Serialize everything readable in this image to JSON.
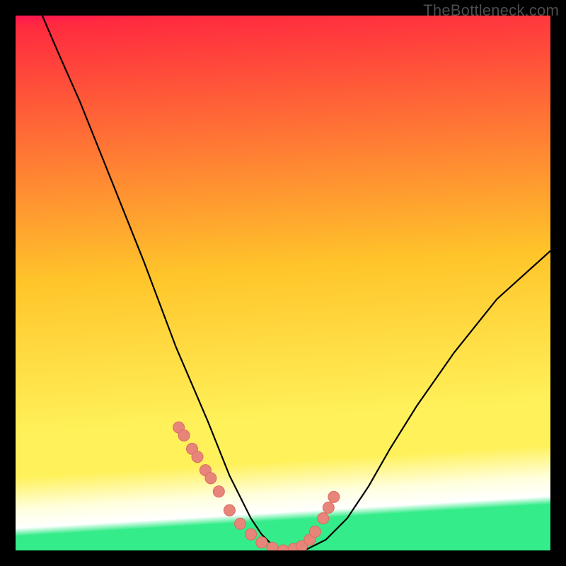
{
  "watermark": "TheBottleneck.com",
  "colors": {
    "grad_top_left": "#ff1452",
    "grad_top_right": "#ff2a3f",
    "grad_mid": "#ffc52a",
    "grad_low": "#fff15a",
    "grad_pale": "#ffffde",
    "grad_green": "#35ec8a",
    "curve": "#000000",
    "beads": "#e8857a",
    "beads_stroke": "#d96c60"
  },
  "chart_data": {
    "type": "line",
    "title": "",
    "xlabel": "",
    "ylabel": "",
    "xlim": [
      0,
      100
    ],
    "ylim": [
      0,
      100
    ],
    "series": [
      {
        "name": "bottleneck-curve",
        "x": [
          5,
          8,
          12,
          16,
          20,
          24,
          27,
          30,
          33,
          36,
          38,
          40,
          42,
          44,
          46,
          48,
          50,
          54,
          58,
          62,
          66,
          70,
          75,
          82,
          90,
          100
        ],
        "y": [
          100,
          93,
          84,
          74,
          64,
          54,
          46,
          38,
          31,
          24,
          19,
          14,
          10,
          6,
          3,
          1,
          0,
          0,
          2,
          6,
          12,
          19,
          27,
          37,
          47,
          56
        ]
      }
    ],
    "markers": {
      "name": "highlighted-points",
      "x": [
        30.5,
        31.5,
        33.0,
        34.0,
        35.5,
        36.5,
        38.0,
        40.0,
        42.0,
        44.0,
        46.0,
        48.0,
        50.0,
        52.0,
        53.5,
        55.0,
        56.0,
        57.5,
        58.5,
        59.5
      ],
      "y": [
        23.0,
        21.5,
        19.0,
        17.5,
        15.0,
        13.5,
        11.0,
        7.5,
        5.0,
        3.0,
        1.5,
        0.5,
        0.0,
        0.3,
        0.8,
        2.0,
        3.5,
        6.0,
        8.0,
        10.0
      ]
    }
  }
}
